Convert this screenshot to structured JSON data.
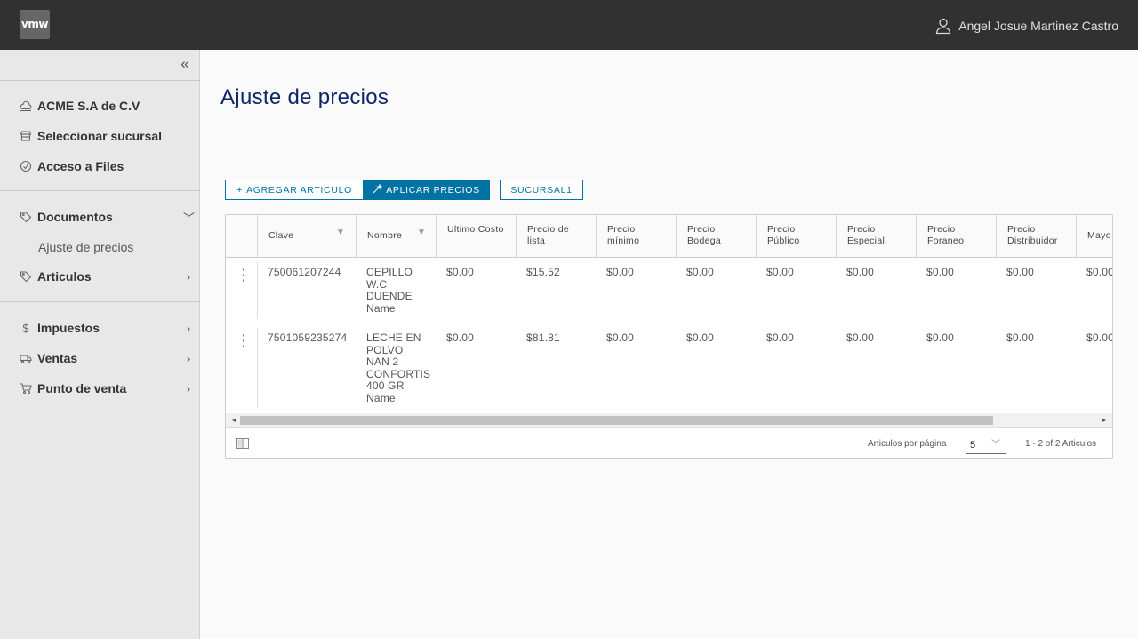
{
  "header": {
    "logo": "vmw",
    "user_name": "Angel Josue Martinez Castro"
  },
  "sidebar": {
    "collapse_icon": "«",
    "company": "ACME S.A de C.V",
    "branch": "Seleccionar sucursal",
    "files": "Acceso a Files",
    "documentos": "Documentos",
    "ajuste": "Ajuste de precios",
    "articulos": "Articulos",
    "impuestos": "Impuestos",
    "ventas": "Ventas",
    "punto_venta": "Punto de venta"
  },
  "main": {
    "title": "Ajuste de precios",
    "btn_agregar": "AGREGAR ARTICULO",
    "btn_aplicar": "APLICAR PRECIOS",
    "btn_sucursal": "SUCURSAL1"
  },
  "grid": {
    "columns": [
      "Clave",
      "Nombre",
      "Ultimo Costo",
      "Precio de lista",
      "Precio mínimo",
      "Precio Bodega",
      "Precio Público",
      "Precio Especial",
      "Precio Foraneo",
      "Precio Distribuidor",
      "Mayo"
    ],
    "rows": [
      {
        "clave": "750061207244",
        "nombre": "CEPILLO W.C DUENDE Name",
        "values": [
          "$0.00",
          "$15.52",
          "$0.00",
          "$0.00",
          "$0.00",
          "$0.00",
          "$0.00",
          "$0.00",
          "$0.00"
        ]
      },
      {
        "clave": "7501059235274",
        "nombre": "LECHE EN POLVO NAN 2 CONFORTIS 400 GR Name",
        "values": [
          "$0.00",
          "$81.81",
          "$0.00",
          "$0.00",
          "$0.00",
          "$0.00",
          "$0.00",
          "$0.00",
          "$0.00"
        ]
      }
    ],
    "footer": {
      "per_page_label": "Articulos por página",
      "per_page_value": "5",
      "range": "1 - 2 of 2 Articulos"
    }
  }
}
